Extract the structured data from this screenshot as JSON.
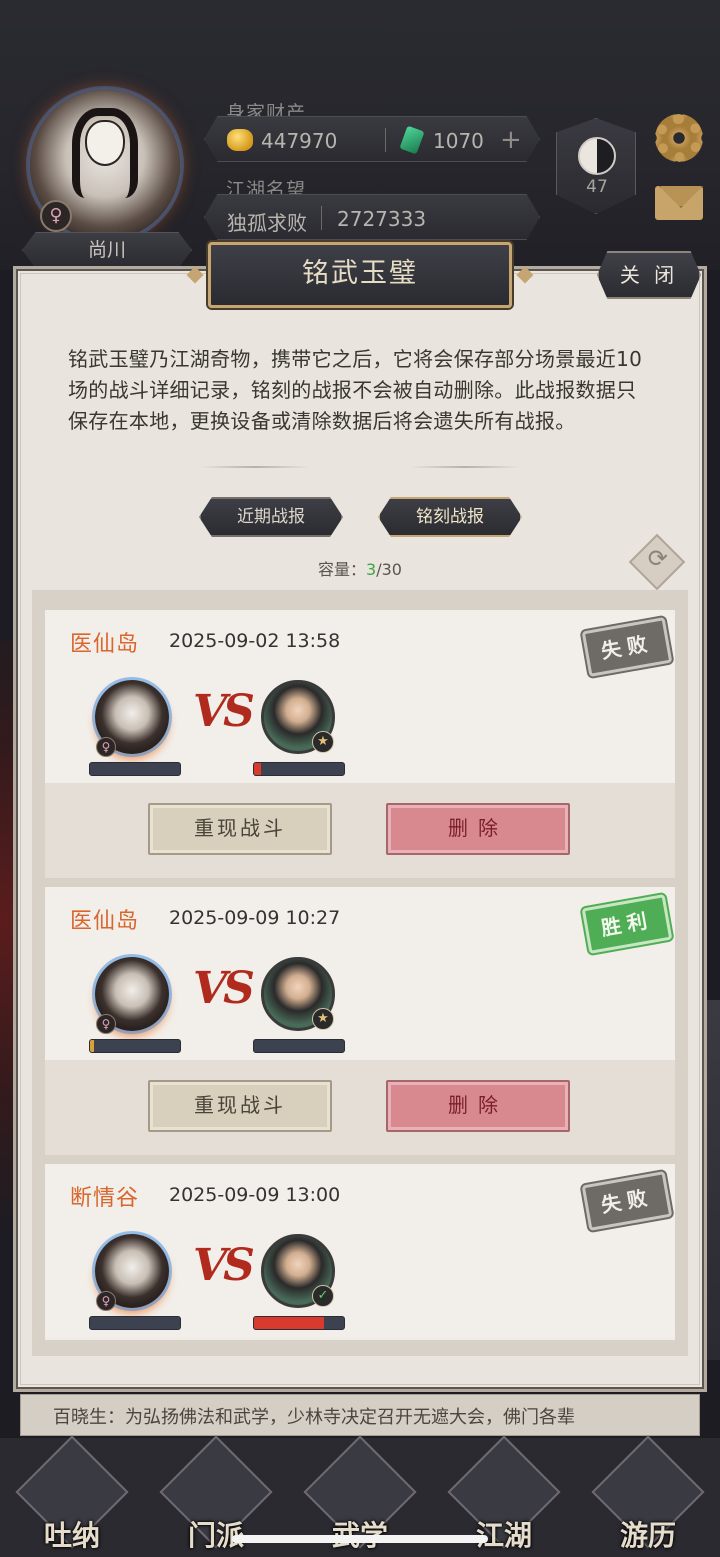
{
  "profile": {
    "name": "尚川",
    "gender_symbol": "♀",
    "wealth_label": "身家财产",
    "coins": "447970",
    "jade": "1070",
    "plus": "+",
    "fame_label": "江湖名望",
    "title": "独孤求败",
    "fame_value": "2727333",
    "level": "47"
  },
  "dialog": {
    "title": "铭武玉璧",
    "close_label": "关 闭",
    "description": "铭武玉璧乃江湖奇物，携带它之后，它将会保存部分场景最近10场的战斗详细记录，铭刻的战报不会被自动删除。此战报数据只保存在本地，更换设备或清除数据后将会遗失所有战报。",
    "tabs": [
      {
        "label": "近期战报",
        "active": false
      },
      {
        "label": "铭刻战报",
        "active": true
      }
    ],
    "capacity_label": "容量：",
    "capacity_used": "3",
    "capacity_total": "/30"
  },
  "battles": [
    {
      "location": "医仙岛",
      "time": "2025-09-02 13:58",
      "result": "失败",
      "result_type": "lose",
      "my_hp": 0.0,
      "enemy_hp": 0.08,
      "enemy_badge": "★",
      "replay_label": "重现战斗",
      "delete_label": "删除"
    },
    {
      "location": "医仙岛",
      "time": "2025-09-09 10:27",
      "result": "胜利",
      "result_type": "win",
      "my_hp": 0.04,
      "enemy_hp": 0.0,
      "enemy_badge": "★",
      "replay_label": "重现战斗",
      "delete_label": "删除"
    },
    {
      "location": "断情谷",
      "time": "2025-09-09 13:00",
      "result": "失败",
      "result_type": "lose",
      "my_hp": 0.0,
      "enemy_hp": 0.78,
      "enemy_badge": "✓",
      "replay_label": "重现战斗",
      "delete_label": "删除"
    }
  ],
  "vs_text": "VS",
  "news": "百晓生：为弘扬佛法和武学，少林寺决定召开无遮大会，佛门各辈",
  "nav": [
    "吐纳",
    "门派",
    "武学",
    "江湖",
    "游历"
  ],
  "colors": {
    "location": "#d8662d",
    "win": "#4fae55",
    "lose": "#6e6a66",
    "hp_low": "#d83a2e",
    "hp_mid": "#d8a23a"
  }
}
